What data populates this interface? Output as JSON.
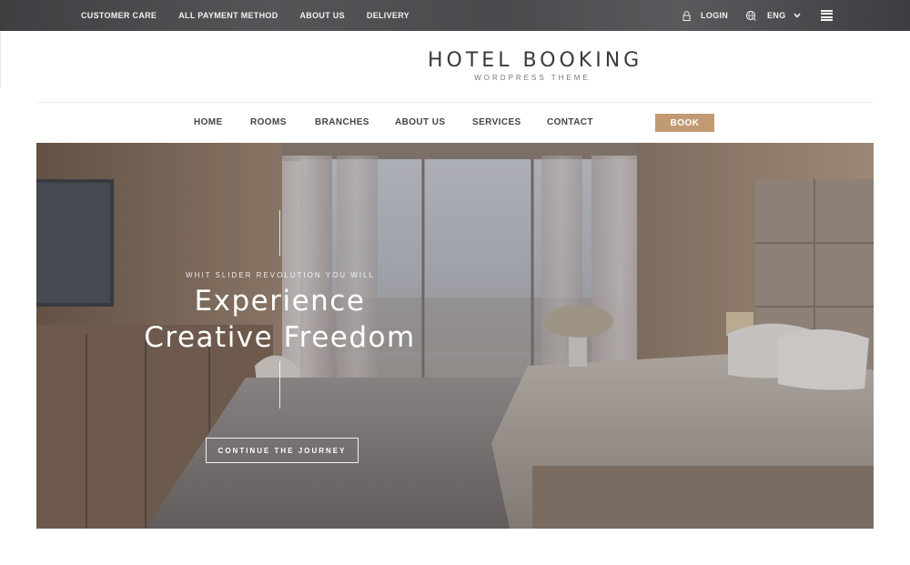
{
  "topbar": {
    "links": [
      "CUSTOMER CARE",
      "ALL PAYMENT METHOD",
      "ABOUT US",
      "DELIVERY"
    ],
    "login_label": "LOGIN",
    "language": "ENG",
    "icons": {
      "login": "lock-icon",
      "language": "globe-icon",
      "dropdown": "chevron-down-icon",
      "menu": "hamburger-menu-icon"
    }
  },
  "brand": {
    "title": "HOTEL BOOKING",
    "subtitle": "WORDPRESS THEME"
  },
  "nav": {
    "items": [
      "HOME",
      "ROOMS",
      "BRANCHES",
      "ABOUT US",
      "SERVICES",
      "CONTACT"
    ],
    "book_label": "BOOK"
  },
  "hero": {
    "kicker": "WHIT SLIDER REVOLUTION YOU WILL",
    "headline_line1": "Experience",
    "headline_line2": "Creative Freedom",
    "cta_label": "CONTINUE THE JOURNEY"
  },
  "colors": {
    "topbar_bg": "#4a4a4d",
    "accent": "#c19a73",
    "text_dark": "#3a3a3a",
    "nav_text": "#444444"
  }
}
